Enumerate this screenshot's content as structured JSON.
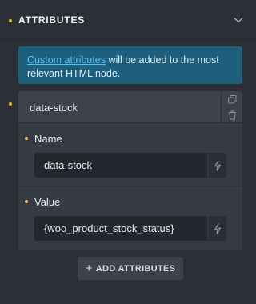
{
  "section": {
    "title": "ATTRIBUTES",
    "toggle_icon": "chevron-down-icon"
  },
  "info": {
    "link_text": "Custom attributes",
    "text": " will be added to the most relevant HTML node."
  },
  "attribute_item": {
    "title": "data-stock",
    "actions": [
      "copy-icon",
      "trash-icon"
    ],
    "name": {
      "label": "Name",
      "value": "data-stock"
    },
    "value": {
      "label": "Value",
      "value": "{woo_product_stock_status}"
    }
  },
  "add_button": {
    "label": "ADD ATTRIBUTES"
  },
  "colors": {
    "background": "#2b2f36",
    "accent_dot": "#f0c43a",
    "info_background": "#1f5f7e",
    "link": "#4fc6f2",
    "input_background": "#24282e"
  }
}
